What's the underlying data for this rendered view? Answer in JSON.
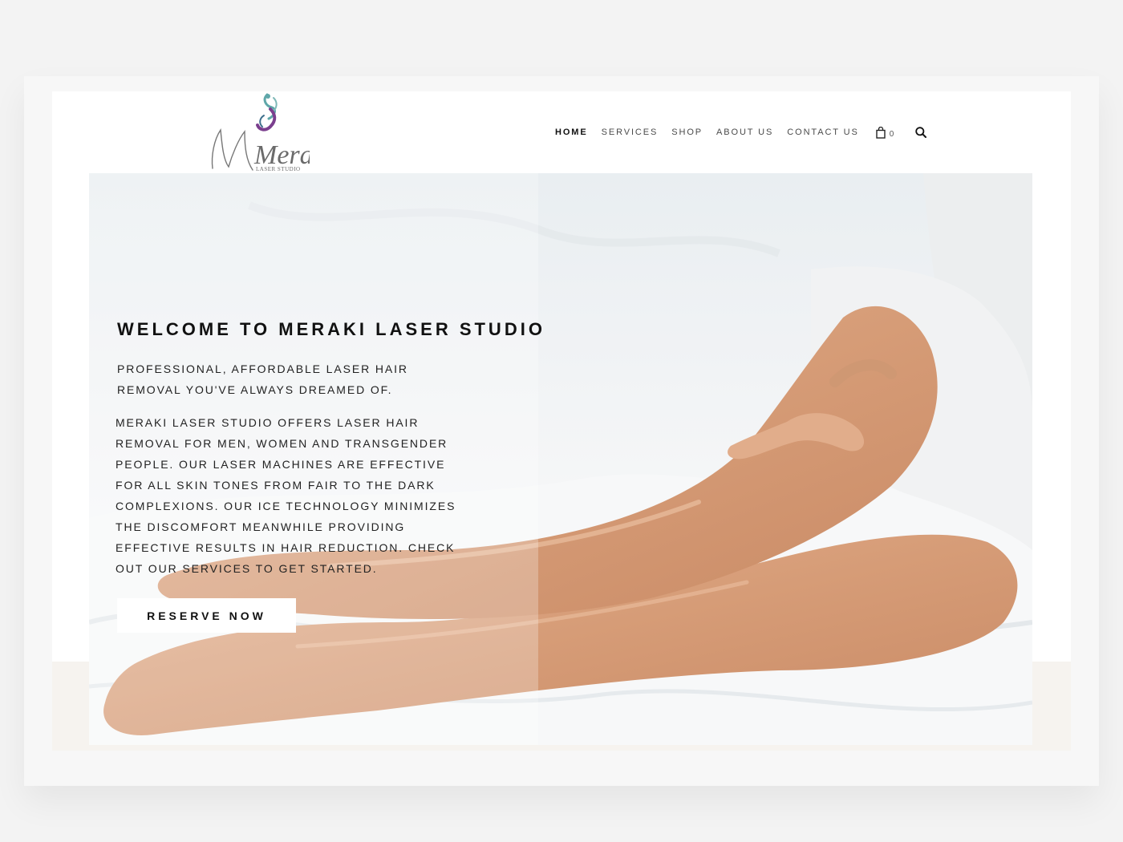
{
  "brand": {
    "logo_text": "Meraki",
    "logo_subtext": "LASER STUDIO"
  },
  "nav": {
    "items": [
      {
        "label": "HOME",
        "active": true
      },
      {
        "label": "SERVICES",
        "active": false
      },
      {
        "label": "SHOP",
        "active": false
      },
      {
        "label": "ABOUT US",
        "active": false
      },
      {
        "label": "CONTACT US",
        "active": false
      }
    ],
    "cart_icon": "shopping-bag-icon",
    "cart_count": "0",
    "search_icon": "search-icon"
  },
  "hero": {
    "title": "WELCOME TO MERAKI LASER STUDIO",
    "subtitle": "PROFESSIONAL, AFFORDABLE LASER HAIR REMOVAL YOU'VE ALWAYS DREAMED OF.",
    "body": "MERAKI LASER STUDIO OFFERS LASER HAIR REMOVAL FOR MEN, WOMEN AND TRANSGENDER PEOPLE. OUR LASER MACHINES ARE EFFECTIVE FOR ALL SKIN TONES FROM FAIR TO THE DARK COMPLEXIONS. OUR ICE TECHNOLOGY MINIMIZES THE DISCOMFORT MEANWHILE PROVIDING EFFECTIVE RESULTS IN HAIR REDUCTION. CHECK OUT OUR SERVICES TO GET STARTED.",
    "cta_label": "RESERVE NOW"
  },
  "colors": {
    "page_bg": "#f3f3f3",
    "site_bg": "#ffffff",
    "band_bg": "#f6f3ef",
    "text": "#111111",
    "logo_teal": "#5fa7a9",
    "logo_purple": "#7b3f8e",
    "skin": "#d9a27f"
  }
}
